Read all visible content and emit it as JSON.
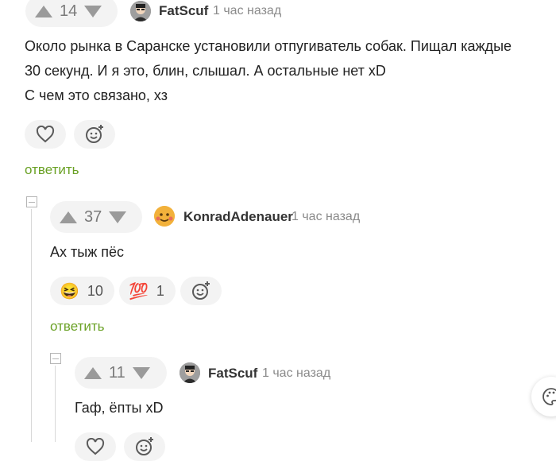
{
  "comments": [
    {
      "rating": "14",
      "author": "FatScuf",
      "time": "1 час назад",
      "lines": [
        "Около рынка в Саранске установили отпугиватель собак. Пищал каждые",
        "30 секунд. И я это, блин, слышал. А остальные нет xD",
        "С чем это связано, хз"
      ],
      "reply_label": "ответить"
    },
    {
      "rating": "37",
      "author": "KonradAdenauer",
      "time": "1 час назад",
      "text": "Ах тыж пёс",
      "reactions": [
        {
          "emoji": "😆",
          "count": "10"
        },
        {
          "emoji": "💯",
          "count": "1"
        }
      ],
      "reply_label": "ответить"
    },
    {
      "rating": "11",
      "author": "FatScuf",
      "time": "1 час назад",
      "text": "Гаф, ёпты xD"
    }
  ],
  "icons": {
    "like": "heart-icon",
    "add_reaction": "add-reaction-icon",
    "upvote": "upvote-icon",
    "downvote": "downvote-icon",
    "collapse": "collapse-icon",
    "theme": "palette-icon"
  },
  "colors": {
    "reply_link": "#6aa125",
    "pill_bg": "#f3f3f3"
  }
}
